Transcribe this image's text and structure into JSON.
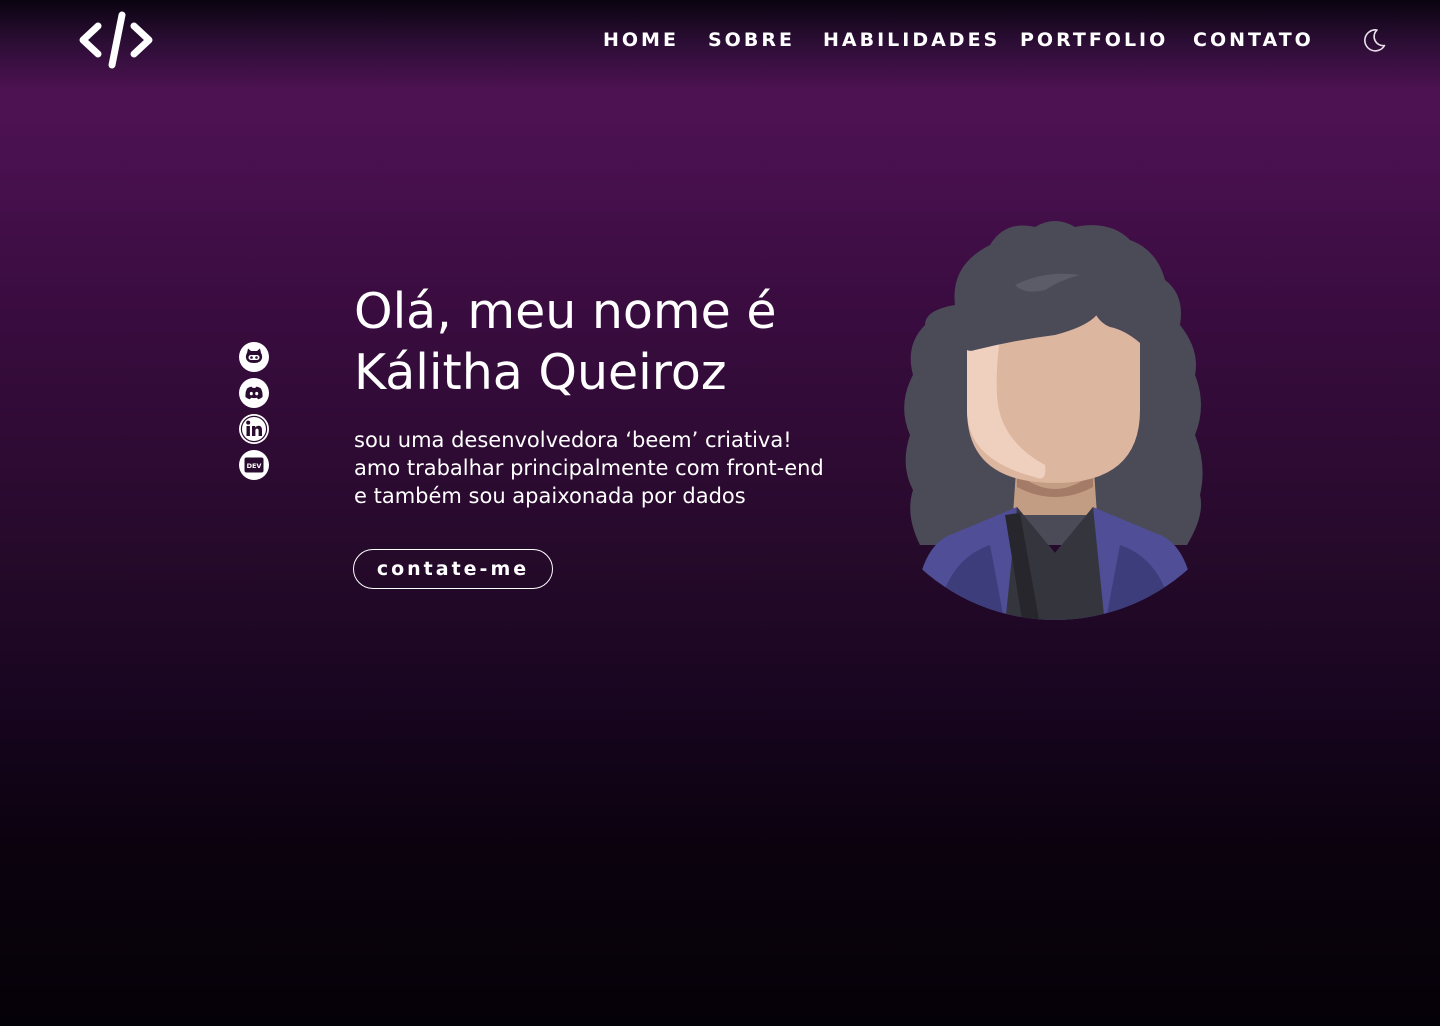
{
  "header": {
    "logo_icon": "code-brackets-icon",
    "nav": [
      {
        "label": "HOME"
      },
      {
        "label": "SOBRE"
      },
      {
        "label": "HABILIDADES"
      },
      {
        "label": "PORTFOLIO"
      },
      {
        "label": "CONTATO"
      }
    ],
    "theme_toggle_icon": "moon-icon"
  },
  "socials": [
    {
      "name": "github",
      "icon": "github-icon"
    },
    {
      "name": "discord",
      "icon": "discord-icon"
    },
    {
      "name": "linkedin",
      "icon": "linkedin-icon"
    },
    {
      "name": "dev",
      "icon": "dev-icon",
      "text": "DEV"
    }
  ],
  "hero": {
    "title_line1": "Olá, meu nome é",
    "title_line2": "Kálitha Queiroz",
    "desc_line1": "sou uma desenvolvedora ‘beem’ criativa!",
    "desc_line2": "amo trabalhar principalmente com front-end",
    "desc_line3": "e também sou apaixonada por dados",
    "cta_label": "contate-me"
  },
  "colors": {
    "background_top": "#4d1252",
    "background_bottom": "#050108",
    "text": "#ffffff"
  }
}
